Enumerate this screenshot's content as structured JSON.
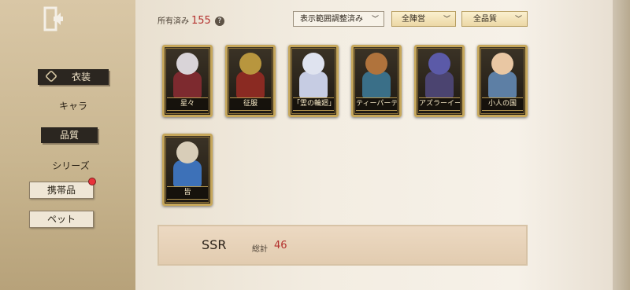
{
  "sidebar": {
    "items": [
      {
        "label": "衣装",
        "active": true
      },
      {
        "label": "キャラ"
      },
      {
        "label": "品質",
        "active": true
      },
      {
        "label": "シリーズ"
      },
      {
        "label": "携帯品",
        "badge": true
      },
      {
        "label": "ペット"
      }
    ]
  },
  "header": {
    "owned_label": "所有済み",
    "owned_count": "155",
    "help_glyph": "?",
    "filter_display": "表示範囲調整済み",
    "filter_camp": "全陣営",
    "filter_quality": "全品質",
    "chevron": "﹀"
  },
  "cards": [
    {
      "label": "星々",
      "icon": "costume-portrait-icon",
      "skin": "#d9d4d8",
      "body": "#7d2a2f"
    },
    {
      "label": "征服",
      "icon": "costume-portrait-icon",
      "skin": "#b8963e",
      "body": "#8a2a22"
    },
    {
      "label": "「霊の輪廻」",
      "icon": "costume-portrait-icon",
      "skin": "#dfe3ef",
      "body": "#c6cce3"
    },
    {
      "label": "ティーパーティー",
      "icon": "costume-portrait-icon",
      "skin": "#b0733c",
      "body": "#3a6f88"
    },
    {
      "label": "アズラーイール",
      "icon": "costume-portrait-icon",
      "skin": "#5b5aa8",
      "body": "#4b4470"
    },
    {
      "label": "小人の国",
      "icon": "costume-portrait-icon",
      "skin": "#e9c7a3",
      "body": "#5d7fa5"
    },
    {
      "label": "皆",
      "icon": "costume-portrait-icon",
      "skin": "#d8cdb8",
      "body": "#3d71b8"
    }
  ],
  "footer": {
    "rarity": "SSR",
    "total_label": "総計",
    "total_value": "46"
  },
  "colors": {
    "accent_red": "#b4322f",
    "gold": "#c6a75b"
  }
}
